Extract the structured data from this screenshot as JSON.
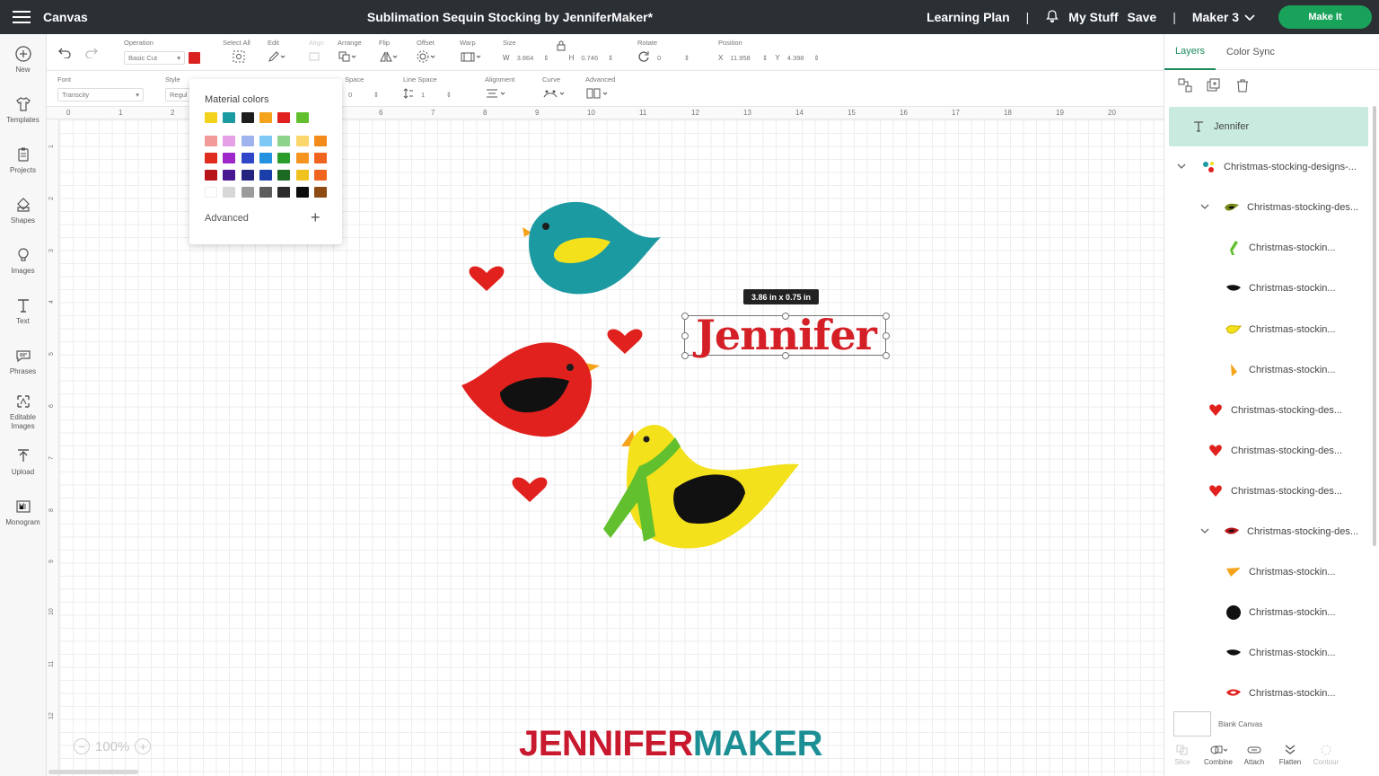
{
  "topbar": {
    "app_name": "Canvas",
    "project_title": "Sublimation Sequin Stocking by JenniferMaker*",
    "learning_plan": "Learning Plan",
    "my_stuff": "My Stuff",
    "save": "Save",
    "machine": "Maker 3",
    "make_it": "Make It",
    "separator": "|"
  },
  "sidebar": {
    "items": [
      {
        "label": "New",
        "icon": "plus-circle-icon"
      },
      {
        "label": "Templates",
        "icon": "shirt-icon"
      },
      {
        "label": "Projects",
        "icon": "clipboard-icon"
      },
      {
        "label": "Shapes",
        "icon": "shapes-icon"
      },
      {
        "label": "Images",
        "icon": "lightbulb-icon"
      },
      {
        "label": "Text",
        "icon": "text-icon"
      },
      {
        "label": "Phrases",
        "icon": "speech-bubble-icon"
      },
      {
        "label": "Editable Images",
        "icon": "editable-image-icon"
      },
      {
        "label": "Upload",
        "icon": "upload-icon"
      },
      {
        "label": "Monogram",
        "icon": "monogram-icon"
      }
    ]
  },
  "toolbar1": {
    "operation_label": "Operation",
    "operation_value": "Basic Cut",
    "select_all": "Select All",
    "edit": "Edit",
    "align": "Align",
    "arrange": "Arrange",
    "flip": "Flip",
    "offset": "Offset",
    "warp": "Warp",
    "size": "Size",
    "w_label": "W",
    "w_value": "3.864",
    "h_label": "H",
    "h_value": "0.746",
    "rotate": "Rotate",
    "rotate_value": "0",
    "position": "Position",
    "x_label": "X",
    "x_value": "11.958",
    "y_label": "Y",
    "y_value": "4.398"
  },
  "toolbar2": {
    "font_label": "Font",
    "font_value": "Transcity",
    "style_label": "Style",
    "style_value": "Regul",
    "space_label": "Space",
    "space_value": "0",
    "line_space_label": "Line Space",
    "line_space_value": "1",
    "alignment": "Alignment",
    "curve": "Curve",
    "advanced": "Advanced"
  },
  "ruler": {
    "top": [
      "0",
      "1",
      "2",
      "3",
      "4",
      "5",
      "6",
      "7",
      "8",
      "9",
      "10",
      "11",
      "12",
      "13",
      "14",
      "15",
      "16",
      "17",
      "18",
      "19",
      "20"
    ],
    "left": [
      "1",
      "2",
      "3",
      "4",
      "5",
      "6",
      "7",
      "8",
      "9",
      "10",
      "11",
      "12"
    ]
  },
  "color_popup": {
    "title": "Material colors",
    "advanced": "Advanced",
    "rows": [
      [
        "#f3d21c",
        "#1c9aa1",
        "#1d1d1d",
        "#f5a31a",
        "#e0211d",
        "#62bf2e"
      ],
      [
        "#f29a9a",
        "#e6a1e6",
        "#9fb3ee",
        "#7ec8f5",
        "#8ed38c",
        "#fbd66c"
      ],
      [
        "#e02b1f",
        "#9d27c8",
        "#3046c9",
        "#2291e0",
        "#2b9d2b",
        "#f5951f"
      ],
      [
        "#b8151a",
        "#4a1793",
        "#22247f",
        "#1b3fa8",
        "#1c6a22",
        "#f0c21e"
      ],
      [
        "#ffffff",
        "#d7d7d7",
        "#9b9b9b",
        "#5d5d5d",
        "#2b2b2b",
        "#0c0c0c"
      ]
    ],
    "last_col": [
      "#f38b1b",
      "#f38b1b",
      "#f0641e",
      "#f0641e",
      "#8d4a12"
    ]
  },
  "canvas": {
    "size_badge": "3.86  in x 0.75  in",
    "text_object": "Jennifer",
    "zoom": "100%",
    "brand_part1": "JENNIFER",
    "brand_part2": "MAKER"
  },
  "layers_panel": {
    "tab_layers": "Layers",
    "tab_color_sync": "Color Sync",
    "layers": [
      {
        "name": "Jennifer",
        "indent": 0,
        "chevron": false,
        "selected": true,
        "icon": "text-layer-icon"
      },
      {
        "name": "Christmas-stocking-designs-...",
        "indent": 1,
        "chevron": true,
        "icon": "group-icon"
      },
      {
        "name": "Christmas-stocking-des...",
        "indent": 2,
        "chevron": true,
        "icon": "bird-group-icon"
      },
      {
        "name": "Christmas-stockin...",
        "indent": 3,
        "chevron": false,
        "icon": "green-scarf-icon"
      },
      {
        "name": "Christmas-stockin...",
        "indent": 3,
        "chevron": false,
        "icon": "black-wing-icon"
      },
      {
        "name": "Christmas-stockin...",
        "indent": 3,
        "chevron": false,
        "icon": "yellow-bird-icon"
      },
      {
        "name": "Christmas-stockin...",
        "indent": 3,
        "chevron": false,
        "icon": "beak-icon"
      },
      {
        "name": "Christmas-stocking-des...",
        "indent": 2,
        "chevron": false,
        "icon": "heart-icon"
      },
      {
        "name": "Christmas-stocking-des...",
        "indent": 2,
        "chevron": false,
        "icon": "heart-icon"
      },
      {
        "name": "Christmas-stocking-des...",
        "indent": 2,
        "chevron": false,
        "icon": "heart-icon"
      },
      {
        "name": "Christmas-stocking-des...",
        "indent": 2,
        "chevron": true,
        "icon": "red-bird-group-icon"
      },
      {
        "name": "Christmas-stockin...",
        "indent": 3,
        "chevron": false,
        "icon": "orange-beak-icon"
      },
      {
        "name": "Christmas-stockin...",
        "indent": 3,
        "chevron": false,
        "icon": "black-circle-icon"
      },
      {
        "name": "Christmas-stockin...",
        "indent": 3,
        "chevron": false,
        "icon": "black-wing-icon"
      },
      {
        "name": "Christmas-stockin...",
        "indent": 3,
        "chevron": false,
        "icon": "red-bird-icon"
      }
    ],
    "blank_canvas": "Blank Canvas",
    "actions": [
      {
        "label": "Slice",
        "enabled": false
      },
      {
        "label": "Combine",
        "enabled": true
      },
      {
        "label": "Attach",
        "enabled": true
      },
      {
        "label": "Flatten",
        "enabled": true
      },
      {
        "label": "Contour",
        "enabled": false
      }
    ]
  },
  "colors": {
    "accent_green": "#1a8a5a",
    "make_it_green": "#19a35a",
    "text_red": "#d41f26"
  }
}
